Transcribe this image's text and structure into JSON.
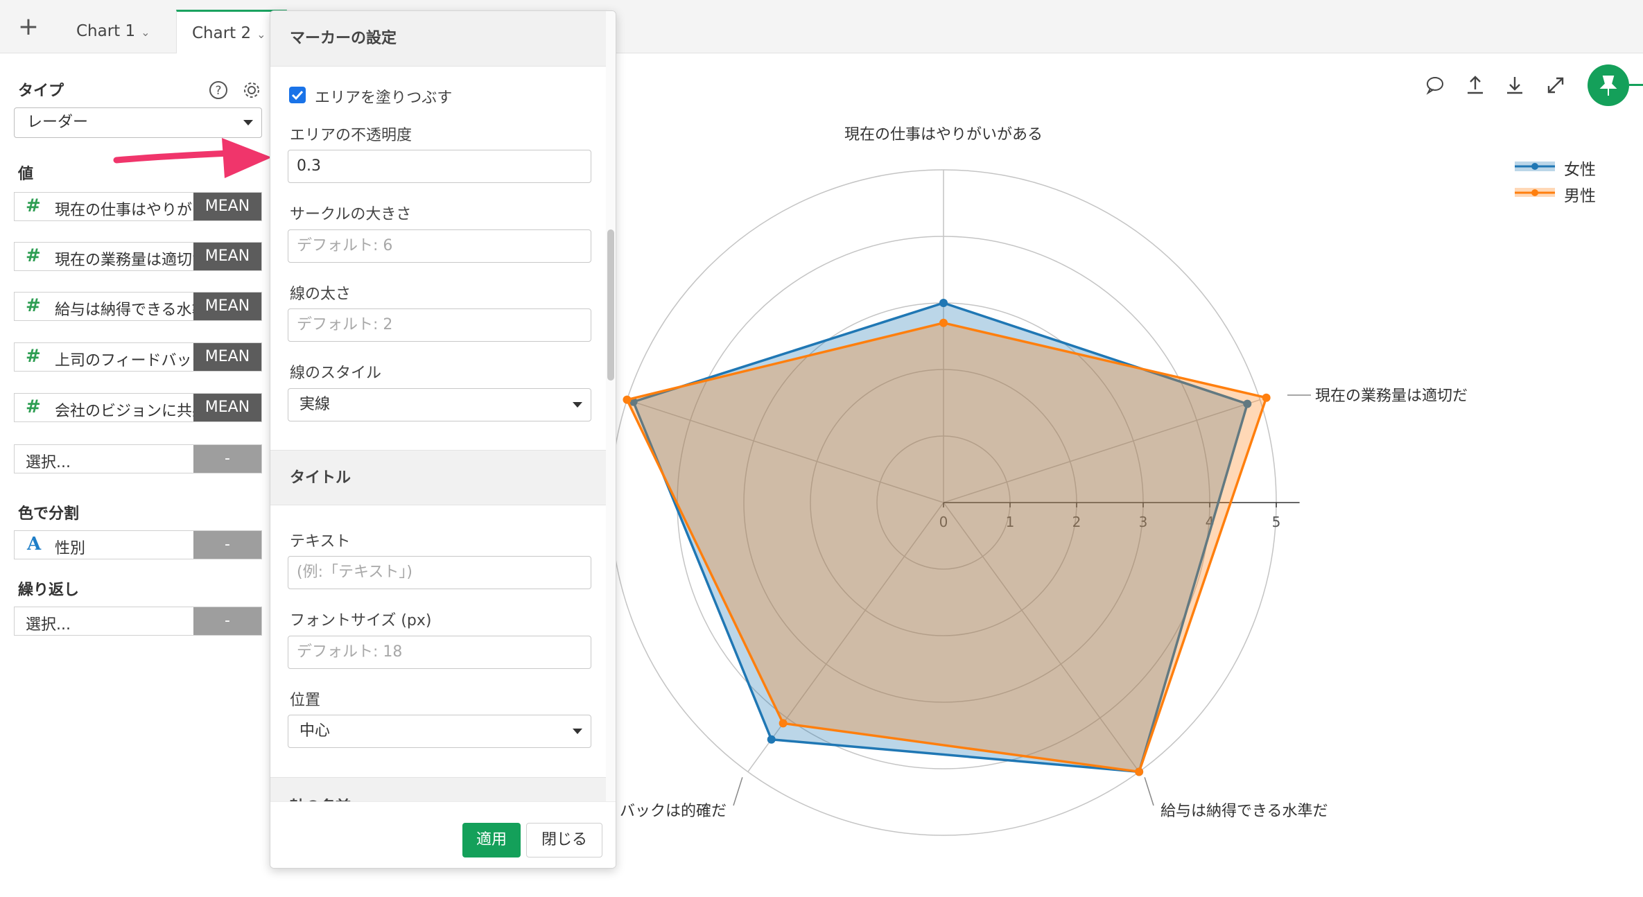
{
  "tabs": {
    "add_label": "+",
    "items": [
      {
        "label": "Chart 1"
      },
      {
        "label": "Chart 2"
      }
    ]
  },
  "sidebar": {
    "type_label": "タイプ",
    "type_value": "レーダー",
    "values_label": "値",
    "values": [
      {
        "name": "現在の仕事はやりがいがある",
        "agg": "MEAN"
      },
      {
        "name": "現在の業務量は適切だ",
        "agg": "MEAN"
      },
      {
        "name": "給与は納得できる水準だ",
        "agg": "MEAN"
      },
      {
        "name": "上司のフィードバックは的確だ",
        "agg": "MEAN"
      },
      {
        "name": "会社のビジョンに共感できる",
        "agg": "MEAN"
      }
    ],
    "value_select_placeholder": "選択...",
    "value_select_dash": "-",
    "color_split_label": "色で分割",
    "color_split_value": "性別",
    "color_split_icon": "A",
    "color_split_dash": "-",
    "repeat_label": "繰り返し",
    "repeat_placeholder": "選択...",
    "repeat_dash": "-"
  },
  "popup": {
    "marker_header": "マーカーの設定",
    "fill_area_label": "エリアを塗りつぶす",
    "fill_area_checked": true,
    "opacity_label": "エリアの不透明度",
    "opacity_value": "0.3",
    "circle_size_label": "サークルの大きさ",
    "circle_size_placeholder": "デフォルト: 6",
    "line_width_label": "線の太さ",
    "line_width_placeholder": "デフォルト: 2",
    "line_style_label": "線のスタイル",
    "line_style_value": "実線",
    "title_header": "タイトル",
    "text_label": "テキスト",
    "text_placeholder": "(例:「テキスト」)",
    "font_size_label": "フォントサイズ (px)",
    "font_size_placeholder": "デフォルト: 18",
    "position_label": "位置",
    "position_value": "中心",
    "next_section_partial": "軸の名前",
    "apply_button": "適用",
    "close_button": "閉じる"
  },
  "accent_colors": {
    "brand_green": "#14a05a",
    "female_series": "#1f77b4",
    "male_series": "#ff7f0e",
    "annotation_arrow": "#f0356b"
  },
  "chart_data": {
    "type": "radar",
    "axes": [
      "現在の仕事はやりがいがある",
      "現在の業務量は適切だ",
      "給与は納得できる水準だ",
      "上司のフィードバックは的確だ",
      "会社のビジョンに共感できる"
    ],
    "axis_labels_visible": [
      "現在の仕事はやりがいがある",
      "現在の業務量は適切だ",
      "給与は納得できる水準だ",
      "バックは的確だ",
      ""
    ],
    "ticks": [
      "0",
      "1",
      "2",
      "3",
      "4",
      "5"
    ],
    "range": [
      0,
      5
    ],
    "rings": [
      1,
      2,
      3,
      4,
      5
    ],
    "area_opacity": 0.3,
    "series": [
      {
        "name": "女性",
        "color": "#1f77b4",
        "values": [
          3.0,
          4.8,
          5.0,
          4.4,
          4.9
        ]
      },
      {
        "name": "男性",
        "color": "#ff7f0e",
        "values": [
          2.7,
          5.1,
          5.0,
          4.1,
          5.0
        ]
      }
    ],
    "legend_position": "top-right"
  }
}
